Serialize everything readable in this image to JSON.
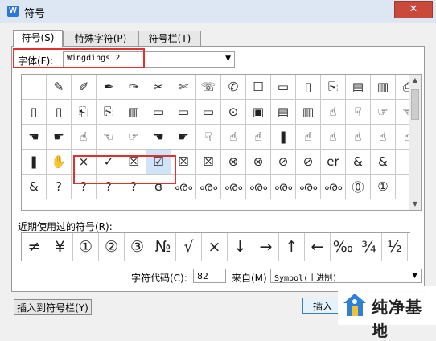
{
  "window": {
    "title": "符号",
    "app_icon_letter": "W",
    "close_symbol": "✕"
  },
  "tabs": [
    {
      "label": "符号(S)"
    },
    {
      "label": "特殊字符(P)"
    },
    {
      "label": "符号栏(T)"
    }
  ],
  "font": {
    "label": "字体(F):",
    "value": "Wingdings 2"
  },
  "symbol_rows": [
    [
      "",
      "✎",
      "✐",
      "✒",
      "✑",
      "✂",
      "✄",
      "☏",
      "✆",
      "☐",
      "▭",
      "▯",
      "⎘",
      "▤",
      "▥",
      "⎙"
    ],
    [
      "▯",
      "▯",
      "⎗",
      "⎘",
      "▥",
      "▭",
      "▭",
      "▭",
      "⊙",
      "▣",
      "▤",
      "▥",
      "☝",
      "☟",
      "☞",
      "☜"
    ],
    [
      "☚",
      "☛",
      "☝",
      "☜",
      "☞",
      "☚",
      "☛",
      "☟",
      "☝",
      "☝",
      "❚",
      "☝",
      "☝",
      "☝",
      "☝",
      "☝"
    ],
    [
      "❚",
      "✋",
      "×",
      "✓",
      "☒",
      "☑",
      "☒",
      "☒",
      "⊗",
      "⊗",
      "⊘",
      "⊘",
      "er",
      "&",
      "&",
      ""
    ],
    [
      "&",
      "?",
      "?",
      "?",
      "?",
      "ɞ",
      "ൟ",
      "ൟ",
      "ൟ",
      "ൟ",
      "ൟ",
      "ൟ",
      "ൟ",
      "⓪",
      "①",
      ""
    ]
  ],
  "selected_symbol": "☑",
  "recent": {
    "label": "近期使用过的符号(R):",
    "symbols": [
      "≠",
      "¥",
      "①",
      "②",
      "③",
      "№",
      "√",
      "×",
      "↓",
      "→",
      "↑",
      "←",
      "‰",
      "¾",
      "½"
    ]
  },
  "code": {
    "label": "字符代码(C):",
    "value": "82"
  },
  "from": {
    "label": "来自(M)",
    "value": "Symbol(十进制)"
  },
  "buttons": {
    "insert_to_bar": "插入到符号栏(Y)",
    "insert": "插入"
  },
  "watermark": {
    "text": "纯净基地"
  },
  "colors": {
    "highlight_border": "#e03030",
    "selected_cell": "#cfe4f7",
    "titlebar": "#dde7f3"
  }
}
